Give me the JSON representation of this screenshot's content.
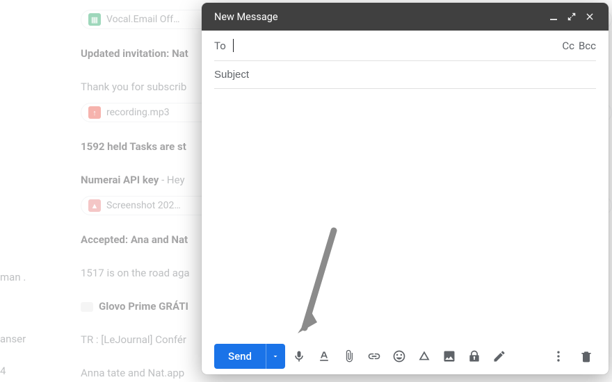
{
  "compose": {
    "title": "New Message",
    "to_label": "To",
    "cc_label": "Cc",
    "bcc_label": "Bcc",
    "subject_placeholder": "Subject",
    "send_label": "Send"
  },
  "background": {
    "chip1": "Vocal.Email Off…",
    "line1_strong": "Updated invitation: Nat",
    "line2_reg": "Thank you for subscrib",
    "chip2": "recording.mp3",
    "line3_strong": "1592 held Tasks are st",
    "line4a": "Numerai API key",
    "line4b": " - Hey",
    "chip3": "Screenshot 202…",
    "line5_strong": "Accepted: Ana and Nat",
    "line6_reg": "1517 is on the road aga",
    "line7_glovo": "Glovo Prime GRÁTI",
    "line8_reg": "TR : [LeJournal] Confér",
    "line9_reg": "Anna tate and Nat.app",
    "left1": "man .",
    "left2": "anser",
    "left3": "4"
  }
}
